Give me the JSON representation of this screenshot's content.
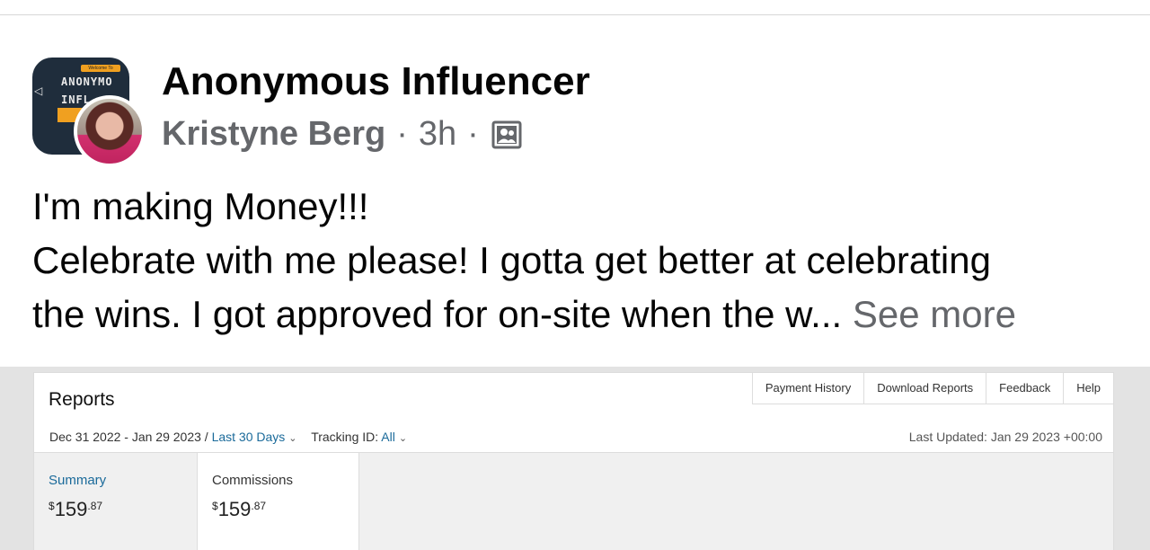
{
  "post": {
    "group_name": "Anonymous Influencer",
    "author": "Kristyne Berg",
    "time": "3h",
    "separator": "·",
    "audience_icon": "group-members-icon",
    "text_lines": [
      "I'm making Money!!!",
      "Celebrate with me please! I gotta get better at celebrating",
      "the wins. I got approved for on-site when the w..."
    ],
    "see_more": "See more",
    "group_avatar": {
      "banner": "Welcome To",
      "line1": "ANONYMO",
      "line2": "INFL"
    }
  },
  "report": {
    "title": "Reports",
    "tabs": [
      "Payment History",
      "Download Reports",
      "Feedback",
      "Help"
    ],
    "date_range": "Dec 31 2022 - Jan 29 2023 /",
    "range_preset": "Last 30 Days",
    "tracking_label": "Tracking ID:",
    "tracking_value": "All",
    "last_updated": "Last Updated: Jan 29 2023 +00:00",
    "summary": {
      "label": "Summary",
      "currency": "$",
      "whole": "159",
      "fraction": ".87"
    },
    "commissions": {
      "label": "Commissions",
      "currency": "$",
      "whole": "159",
      "fraction": ".87"
    }
  },
  "colors": {
    "text": "#050505",
    "secondary": "#65676b",
    "link": "#1a6a9a"
  }
}
